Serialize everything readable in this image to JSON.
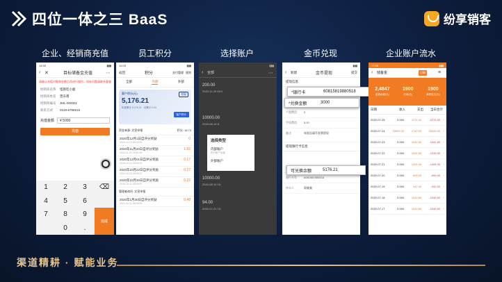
{
  "header": {
    "title": "四位一体之三 BaaS",
    "brand": "纷享销客"
  },
  "sections": [
    "企业、经销商充值",
    "员工积分",
    "选择账户",
    "金币兑现",
    "企业账户流水"
  ],
  "phone1": {
    "time": "14:53",
    "title": "目标储备金充值",
    "notice": "请确认充值对象和金额后再进行操作，如有问题请联系客服",
    "rows": [
      {
        "k": "经销商名称",
        "v": "怪兽吃小鹿"
      },
      {
        "k": "经销商姓名",
        "v": "曾东南"
      },
      {
        "k": "经销商编号",
        "v": "JML-000001"
      },
      {
        "k": "联系方式",
        "v": "0319-6756519"
      }
    ],
    "amount_label": "充值金额",
    "amount_value": "¥ 5000",
    "button": "充值",
    "keys": [
      "1",
      "2",
      "3",
      "⌫",
      "4",
      "5",
      "6",
      "7",
      "8",
      "9",
      "完成",
      "",
      "0",
      "."
    ]
  },
  "phone2": {
    "time": "14:03",
    "left": "返回",
    "title": "积分",
    "right1": "支付管理",
    "right2": "规则",
    "tabs": [
      "全部",
      "内部",
      "外部"
    ],
    "card": {
      "label": "客户积分(元)",
      "amount": "5,176.21",
      "sub": "年度累计 5,176.21  ·  月累计 0.00",
      "btn": "兑现",
      "chip": "客户积分: 93.76"
    },
    "section1": "资金来源: 文宣申报",
    "section1_right": "积分: 18.73",
    "items": [
      {
        "t": "2020年12月1日自评分奖励",
        "d": "2020-12-13 08:00:00",
        "n": "0"
      },
      {
        "t": "2020年11月20日自评分奖励",
        "d": "2020-11-21 09:40:06",
        "n": "1.82"
      },
      {
        "t": "2020年12月01日自评分奖励",
        "d": "2020-12-01 08:00:00",
        "n": "0.17"
      },
      {
        "t": "2020年10月22日自评分奖励",
        "d": "2020-10-23 08:00:07",
        "n": "0.27"
      },
      {
        "t": "2020年10月30日自评分奖励",
        "d": "2020-10-31 08:00:07",
        "n": "0.22"
      }
    ],
    "section2": "管理者询问: 文宣申报",
    "items2": [
      {
        "t": "2020年1月30日自评分奖励",
        "d": "2021-02-01 08:00:00",
        "n": "0.48"
      }
    ]
  },
  "phone3": {
    "title": "全部",
    "lines": [
      "200.00",
      "2020-11-29 08:0",
      "10000.00",
      "2020-08-19 8:",
      "10000.00",
      "2020-08-14 10:",
      "94.00",
      "2020-07-21 10:"
    ],
    "modal_title": "选择类型",
    "opt1": "内部账户",
    "opt1_sub": "积分账户余额",
    "opt2": "外部账户"
  },
  "phone4": {
    "left": "新建",
    "title": "金币提现",
    "right": "提交",
    "group1": "提现信息",
    "rows1": [
      {
        "k": "个税费用",
        "v": "0"
      },
      {
        "k": "手续费用",
        "v": "5.00"
      },
      {
        "k": "备注",
        "v": "年报告填写发票提现"
      }
    ],
    "group2": "提现银行卡信息",
    "rows2": [
      {
        "k": "可兑换余额",
        "v": "5176.21"
      },
      {
        "k": "银行卡号",
        "v": "6081581980518"
      },
      {
        "k": "持卡人",
        "v": "郭美美"
      }
    ],
    "pop1_k": "*银行卡",
    "pop1_v": "60815819880518",
    "pop2_k": "*兑换金额",
    "pop2_v": "3000",
    "pop3_k": "可兑换余额",
    "pop3_v": "5176.21"
  },
  "phone5": {
    "time": "17:30",
    "title": "储备金",
    "tag": "日期",
    "stats": [
      {
        "val": "2,4847",
        "lab": "金额余额(元)"
      },
      {
        "val": "1900",
        "lab": "已收(元)"
      },
      {
        "val": "1900",
        "lab": "本周支出(元)"
      }
    ],
    "columns": [
      "日期",
      "收入",
      "支出",
      "当日合计"
    ],
    "rows": [
      [
        "2020-07-25",
        "0.000",
        "2274.00",
        "-2274.00"
      ],
      [
        "2020-07-24",
        "18000.00",
        "1740.00",
        "16260.00"
      ],
      [
        "2020-07-23",
        "0.000",
        "1942.80",
        "-1941.80"
      ],
      [
        "2020-07-22",
        "0.000",
        "1539.50",
        "-1539.50"
      ],
      [
        "2020-07-21",
        "0.000",
        "1405.30",
        "-1405.30"
      ],
      [
        "2020-07-20",
        "0.000",
        "699.00",
        "-699.00"
      ],
      [
        "2020-07-19",
        "0.000",
        "942.00",
        "-942.00"
      ],
      [
        "2020-07-18",
        "0.000",
        "1049.80",
        "-1049.80"
      ],
      [
        "2020-07-17",
        "0.000",
        "1049.80",
        "-1049.80"
      ]
    ]
  },
  "footer": {
    "slogan": "渠道精耕 · 赋能业务"
  }
}
